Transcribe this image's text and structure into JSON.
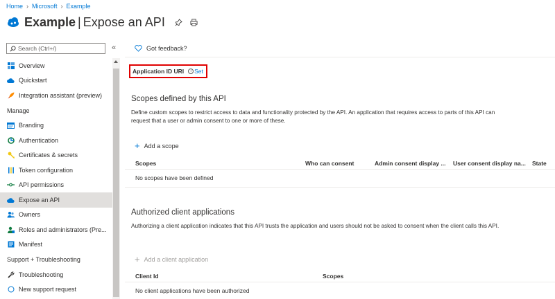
{
  "breadcrumb": [
    "Home",
    "Microsoft",
    "Example"
  ],
  "title": {
    "app": "Example",
    "separator": "|",
    "page": "Expose an API"
  },
  "search": {
    "placeholder": "Search (Ctrl+/)"
  },
  "sidebar": {
    "items": [
      {
        "label": "Overview",
        "icon": "overview-icon"
      },
      {
        "label": "Quickstart",
        "icon": "cloud-icon"
      },
      {
        "label": "Integration assistant (preview)",
        "icon": "rocket-icon"
      }
    ],
    "manage_header": "Manage",
    "manage_items": [
      {
        "label": "Branding",
        "icon": "branding-icon"
      },
      {
        "label": "Authentication",
        "icon": "authentication-icon"
      },
      {
        "label": "Certificates & secrets",
        "icon": "key-icon"
      },
      {
        "label": "Token configuration",
        "icon": "token-icon"
      },
      {
        "label": "API permissions",
        "icon": "api-permissions-icon"
      },
      {
        "label": "Expose an API",
        "icon": "cloud-icon",
        "active": true
      },
      {
        "label": "Owners",
        "icon": "owners-icon"
      },
      {
        "label": "Roles and administrators (Pre...",
        "icon": "roles-icon"
      },
      {
        "label": "Manifest",
        "icon": "manifest-icon"
      }
    ],
    "support_header": "Support + Troubleshooting",
    "support_items": [
      {
        "label": "Troubleshooting",
        "icon": "wrench-icon"
      },
      {
        "label": "New support request",
        "icon": "support-icon"
      }
    ]
  },
  "main": {
    "feedback": "Got feedback?",
    "app_id_uri": {
      "label": "Application ID URI",
      "info": "i",
      "action": "Set"
    },
    "scopes": {
      "heading": "Scopes defined by this API",
      "description": "Define custom scopes to restrict access to data and functionality protected by the API. An application that requires access to parts of this API can request that a user or admin consent to one or more of these.",
      "add": "Add a scope",
      "columns": [
        "Scopes",
        "Who can consent",
        "Admin consent display ...",
        "User consent display na...",
        "State"
      ],
      "empty": "No scopes have been defined"
    },
    "clients": {
      "heading": "Authorized client applications",
      "description": "Authorizing a client application indicates that this API trusts the application and users should not be asked to consent when the client calls this API.",
      "add": "Add a client application",
      "columns": [
        "Client Id",
        "Scopes"
      ],
      "empty": "No client applications have been authorized"
    }
  },
  "colors": {
    "accent": "#0078d4",
    "highlight_border": "#e00000",
    "active_bg": "#e1dfdd"
  }
}
